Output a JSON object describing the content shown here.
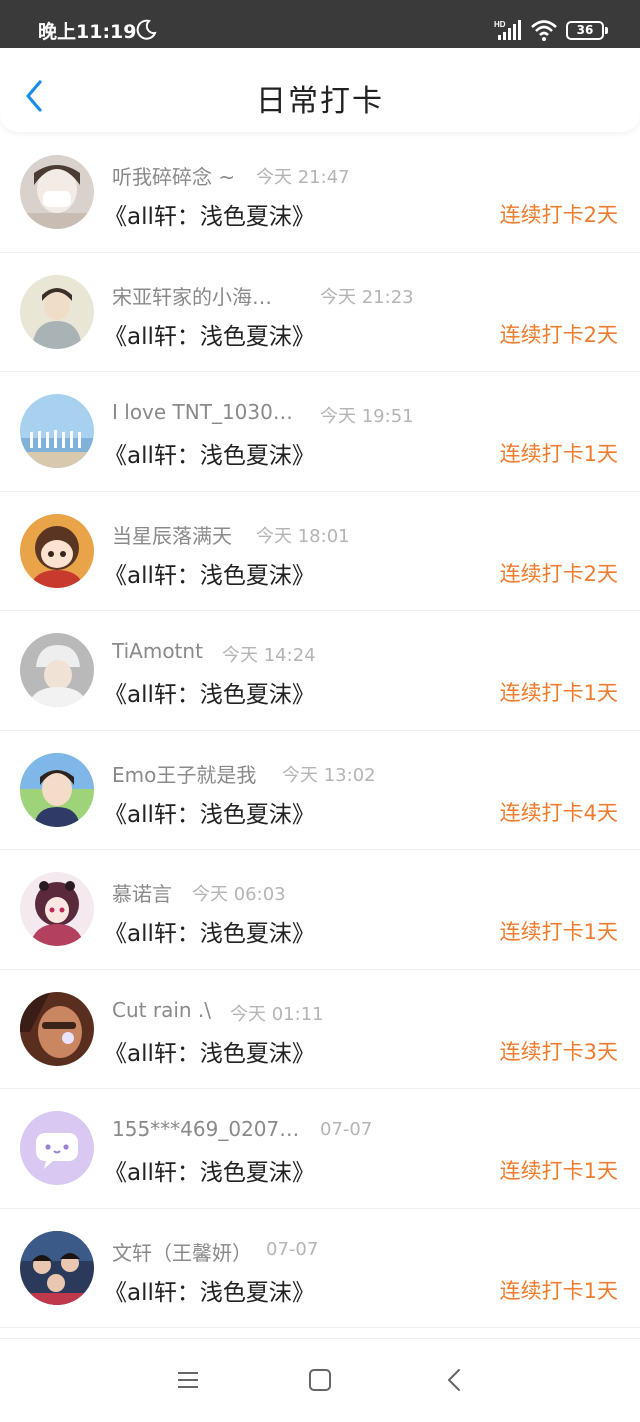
{
  "status_bar": {
    "time": "晚上11:19",
    "battery": "36",
    "icons": [
      "moon-icon",
      "hd-signal-icon",
      "wifi-icon",
      "battery-icon"
    ]
  },
  "header": {
    "title": "日常打卡",
    "back_icon": "chevron-left-icon"
  },
  "items": [
    {
      "username": "听我碎碎念 ~",
      "time": "今天 21:47",
      "title": "《all轩：浅色夏沫》",
      "streak": "连续打卡2天"
    },
    {
      "username": "宋亚轩家的小海…",
      "time": "今天 21:23",
      "title": "《all轩：浅色夏沫》",
      "streak": "连续打卡2天"
    },
    {
      "username": "I love TNT_1030…",
      "time": "今天 19:51",
      "title": "《all轩：浅色夏沫》",
      "streak": "连续打卡1天"
    },
    {
      "username": "当星辰落满天",
      "time": "今天 18:01",
      "title": "《all轩：浅色夏沫》",
      "streak": "连续打卡2天"
    },
    {
      "username": "TiAmotnt",
      "time": "今天 14:24",
      "title": "《all轩：浅色夏沫》",
      "streak": "连续打卡1天"
    },
    {
      "username": "Emo王子就是我",
      "time": "今天 13:02",
      "title": "《all轩：浅色夏沫》",
      "streak": "连续打卡4天"
    },
    {
      "username": "慕诺言",
      "time": "今天 06:03",
      "title": "《all轩：浅色夏沫》",
      "streak": "连续打卡1天"
    },
    {
      "username": "Cut rain .\\",
      "time": "今天 01:11",
      "title": "《all轩：浅色夏沫》",
      "streak": "连续打卡3天"
    },
    {
      "username": "155***469_0207…",
      "time": "07-07",
      "title": "《all轩：浅色夏沫》",
      "streak": "连续打卡1天"
    },
    {
      "username": "文轩（王馨妍）",
      "time": "07-07",
      "title": "《all轩：浅色夏沫》",
      "streak": "连续打卡1天"
    }
  ],
  "nav_bar": {
    "icons": [
      "menu-icon",
      "home-square-icon",
      "back-triangle-icon"
    ]
  },
  "colors": {
    "status_bar_bg": "#3a3a3a",
    "accent_blue": "#1a8ee8",
    "streak_orange": "#f07c2e",
    "username_gray": "#8a8a8a",
    "time_gray": "#b5b5b5",
    "title_dark": "#222222"
  }
}
